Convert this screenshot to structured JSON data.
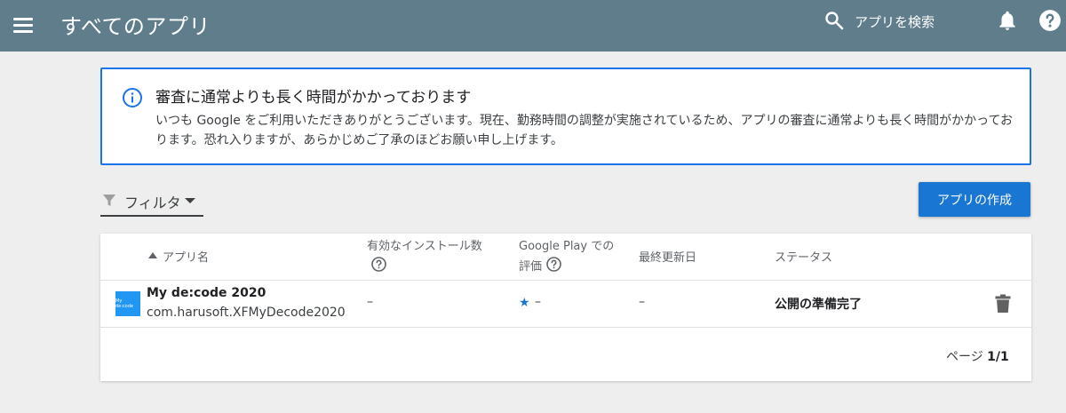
{
  "header": {
    "title": "すべてのアプリ",
    "search_label": "アプリを検索"
  },
  "notice": {
    "title": "審査に通常よりも長く時間がかかっております",
    "body": "いつも Google をご利用いただきありがとうございます。現在、勤務時間の調整が実施されているため、アプリの審査に通常よりも長く時間がかかっております。恐れ入りますが、あらかじめご了承のほどお願い申し上げます。"
  },
  "toolbar": {
    "filter_label": "フィルタ",
    "create_label": "アプリの作成"
  },
  "table": {
    "headers": {
      "app_name": "アプリ名",
      "installs": "有効なインストール数",
      "rating_line1": "Google Play での",
      "rating_line2": "評価",
      "updated": "最終更新日",
      "status": "ステータス"
    },
    "rows": [
      {
        "thumb_text": "My de:code",
        "name": "My de:code 2020",
        "package": "com.harusoft.XFMyDecode2020",
        "installs": "–",
        "rating": "–",
        "updated": "–",
        "status": "公開の準備完了"
      }
    ]
  },
  "pager": {
    "prefix": "ページ ",
    "value": "1/1"
  },
  "colors": {
    "topbar": "#607d8b",
    "accent": "#1976d2",
    "notice_border": "#1a73e8"
  },
  "icons": [
    "menu-icon",
    "search-icon",
    "bell-icon",
    "help-icon",
    "info-icon",
    "filter-icon",
    "help-circle-icon",
    "star-icon",
    "trash-icon"
  ]
}
